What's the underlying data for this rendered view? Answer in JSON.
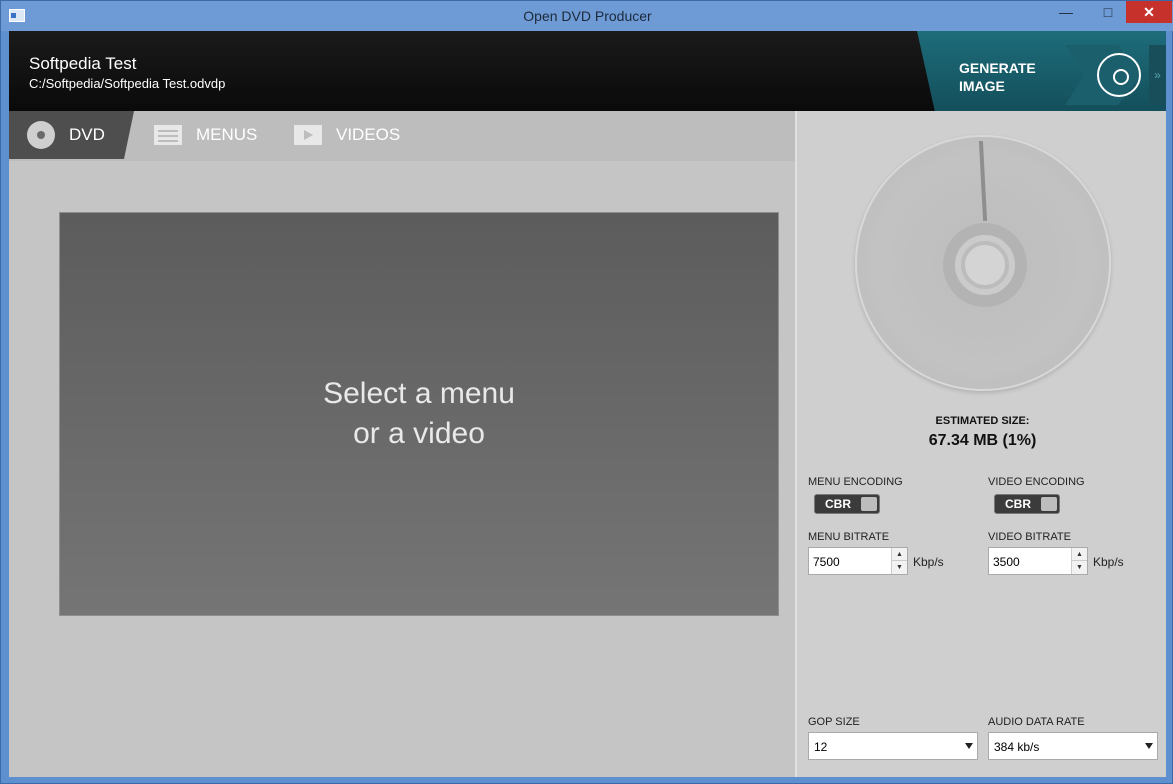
{
  "window": {
    "title": "Open DVD Producer"
  },
  "header": {
    "project_title": "Softpedia Test",
    "project_path": "C:/Softpedia/Softpedia Test.odvdp",
    "generate_label": "GENERATE IMAGE"
  },
  "tabs": [
    {
      "label": "DVD",
      "icon": "disc-icon",
      "active": true
    },
    {
      "label": "MENUS",
      "icon": "menu-list-icon",
      "active": false
    },
    {
      "label": "VIDEOS",
      "icon": "video-play-icon",
      "active": false
    }
  ],
  "preview": {
    "message_line1": "Select a menu",
    "message_line2": "or a video"
  },
  "side": {
    "estimated_size_label": "ESTIMATED SIZE:",
    "estimated_size_value": "67.34 MB (1%)",
    "menu_encoding_label": "MENU ENCODING",
    "menu_encoding_value": "CBR",
    "video_encoding_label": "VIDEO ENCODING",
    "video_encoding_value": "CBR",
    "menu_bitrate_label": "MENU BITRATE",
    "menu_bitrate_value": "7500",
    "video_bitrate_label": "VIDEO BITRATE",
    "video_bitrate_value": "3500",
    "bitrate_unit": "Kbp/s",
    "gop_size_label": "GOP SIZE",
    "gop_size_value": "12",
    "audio_rate_label": "AUDIO DATA RATE",
    "audio_rate_value": "384 kb/s"
  },
  "colors": {
    "header_bg": "#111111",
    "accent_teal": "#1e6c7a",
    "active_tab": "#4e4e4e"
  }
}
